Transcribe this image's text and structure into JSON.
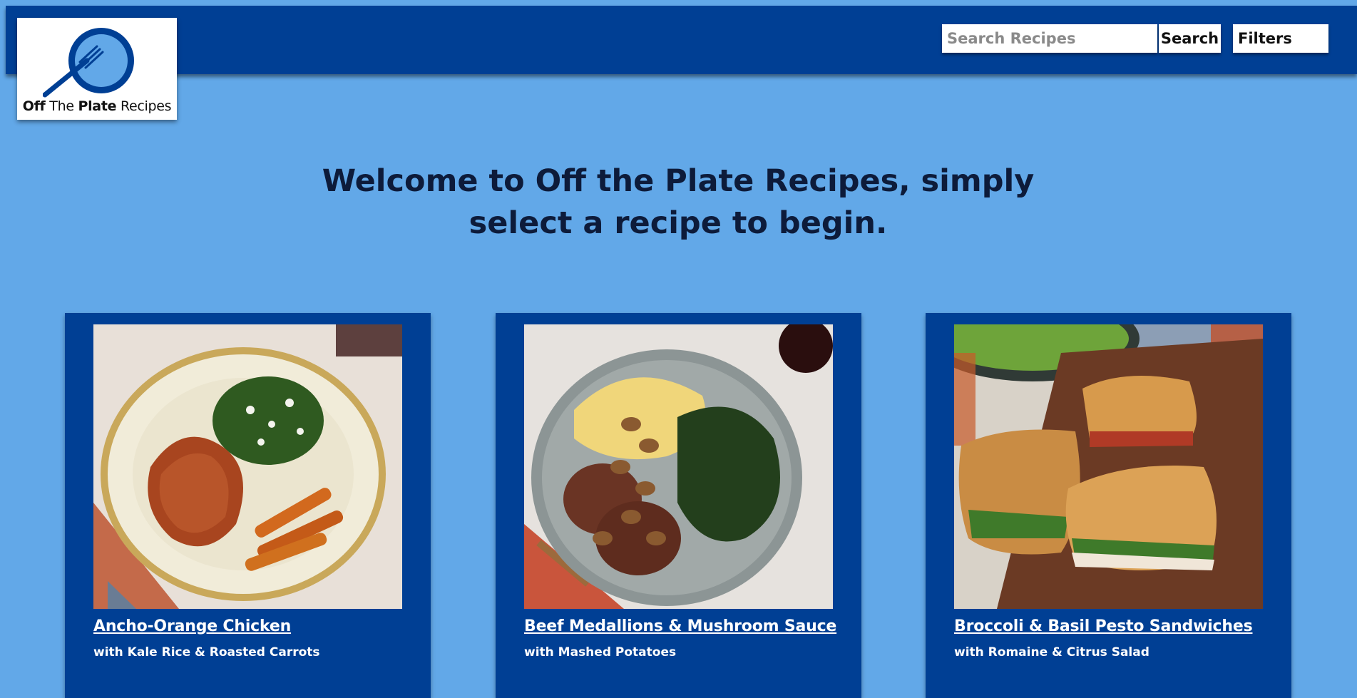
{
  "app": {
    "logo_text_parts": [
      "Off",
      "The",
      "Plate",
      "Recipes"
    ],
    "colors": {
      "background": "#62a8e8",
      "header": "#003f94",
      "card": "#003f94"
    }
  },
  "header": {
    "search": {
      "placeholder": "Search Recipes",
      "value": ""
    },
    "search_button": "Search",
    "filters_button": "Filters"
  },
  "main": {
    "welcome": "Welcome to Off the Plate Recipes, simply select a recipe to begin."
  },
  "recipes": [
    {
      "title": "Ancho-Orange Chicken",
      "subtitle": "with Kale Rice & Roasted Carrots"
    },
    {
      "title": "Beef Medallions & Mushroom Sauce",
      "subtitle": "with Mashed Potatoes"
    },
    {
      "title": "Broccoli & Basil Pesto Sandwiches",
      "subtitle": "with Romaine & Citrus Salad"
    }
  ]
}
